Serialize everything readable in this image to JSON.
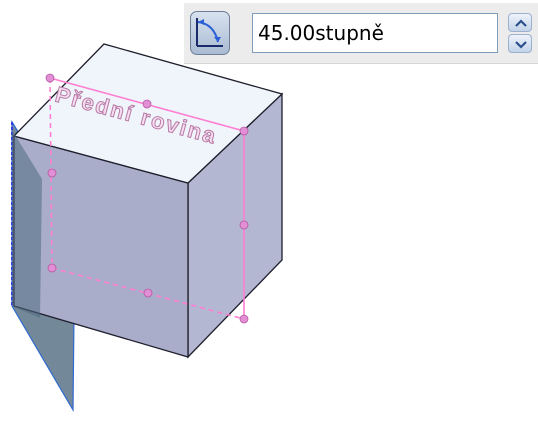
{
  "scene": {
    "plane_label": "Přední rovina",
    "colors": {
      "box_top": "#f0f5fc",
      "box_front": "#a9adc9",
      "box_right": "#b4b7d2",
      "box_edge": "#1e1e2c",
      "plane_fill": "#5a7386",
      "plane_edge": "#2f6ad0",
      "selection": "#ff7ed2",
      "handle": "#e38fd6"
    }
  },
  "toolbar": {
    "angle_icon": "angle-icon",
    "value": "45.00stupně",
    "spin_up_icon": "chevron-up-icon",
    "spin_down_icon": "chevron-down-icon"
  }
}
